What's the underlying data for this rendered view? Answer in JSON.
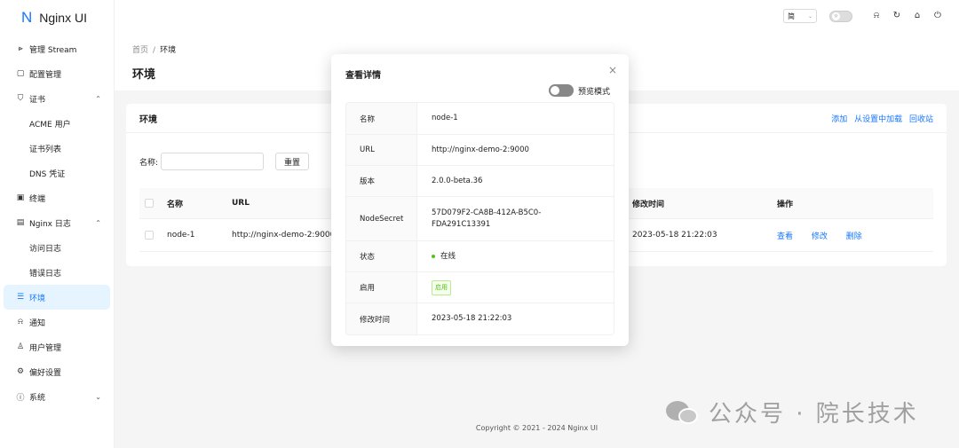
{
  "app": {
    "logo_letter": "N",
    "logo_text": "Nginx UI"
  },
  "sidebar": {
    "items": [
      {
        "icon": "share",
        "glyph": "⩺",
        "label": "管理 Stream"
      },
      {
        "icon": "file",
        "glyph": "▢",
        "label": "配置管理"
      },
      {
        "icon": "shield",
        "glyph": "⛉",
        "label": "证书",
        "arrow": "⌃"
      },
      {
        "sub": true,
        "label": "ACME 用户"
      },
      {
        "sub": true,
        "label": "证书列表"
      },
      {
        "sub": true,
        "label": "DNS 凭证"
      },
      {
        "icon": "terminal",
        "glyph": "▣",
        "label": "终端"
      },
      {
        "icon": "file-text",
        "glyph": "▤",
        "label": "Nginx 日志",
        "arrow": "⌃"
      },
      {
        "sub": true,
        "label": "访问日志"
      },
      {
        "sub": true,
        "label": "错误日志"
      },
      {
        "icon": "database",
        "glyph": "☰",
        "label": "环境",
        "active": true
      },
      {
        "icon": "bell",
        "glyph": "⍾",
        "label": "通知"
      },
      {
        "icon": "user",
        "glyph": "♙",
        "label": "用户管理"
      },
      {
        "icon": "gear",
        "glyph": "⚙",
        "label": "偏好设置"
      },
      {
        "icon": "info",
        "glyph": "ⓘ",
        "label": "系统",
        "arrow": "⌄"
      }
    ]
  },
  "header": {
    "lang": "简",
    "lang_chev": "⌄"
  },
  "breadcrumb": {
    "home": "首页",
    "sep": "/",
    "current": "环境"
  },
  "page": {
    "title": "环境"
  },
  "card": {
    "title": "环境",
    "actions": [
      "添加",
      "从设置中加载",
      "回收站"
    ],
    "search_label": "名称:",
    "reset": "重置"
  },
  "table": {
    "headers": {
      "name": "名称",
      "url": "URL",
      "time": "修改时间",
      "ops": "操作"
    },
    "rows": [
      {
        "name": "node-1",
        "url": "http://nginx-demo-2:9000",
        "time": "2023-05-18 21:22:03",
        "ops": [
          "查看",
          "修改",
          "删除"
        ]
      }
    ]
  },
  "modal": {
    "title": "查看详情",
    "close": "×",
    "preview_label": "预览模式",
    "rows": [
      {
        "label": "名称",
        "value": "node-1"
      },
      {
        "label": "URL",
        "value": "http://nginx-demo-2:9000"
      },
      {
        "label": "版本",
        "value": "2.0.0-beta.36"
      },
      {
        "label": "NodeSecret",
        "value1": "57D079F2-CA8B-412A-B5C0-",
        "value2": "FDA291C13391"
      },
      {
        "label": "状态",
        "value": "在线"
      },
      {
        "label": "启用",
        "value": "启用"
      },
      {
        "label": "修改时间",
        "value": "2023-05-18 21:22:03"
      }
    ]
  },
  "footer": {
    "text": "Copyright © 2021 - 2024 Nginx UI"
  },
  "watermark": {
    "text": "公众号 · 院长技术"
  }
}
